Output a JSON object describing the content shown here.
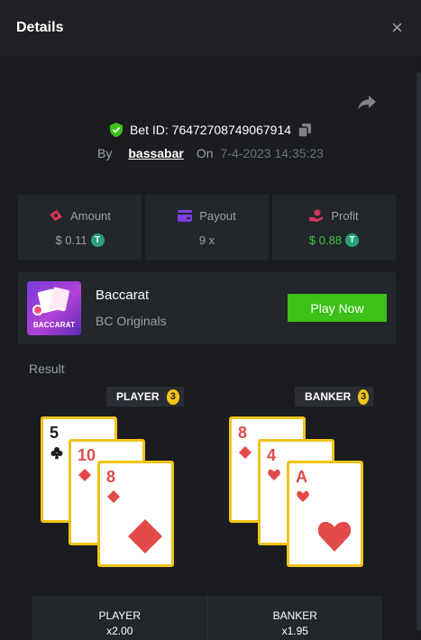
{
  "header": {
    "title": "Details",
    "close_label": "×"
  },
  "bet": {
    "id_label": "Bet ID: 76472708749067914",
    "by_label": "By",
    "user": "bassabar",
    "on_label": "On",
    "date": "7-4-2023 14:35:23"
  },
  "stats": {
    "amount": {
      "label": "Amount",
      "value": "$ 0.11",
      "icon": "money-icon"
    },
    "payout": {
      "label": "Payout",
      "value": "9 x",
      "icon": "wallet-icon"
    },
    "profit": {
      "label": "Profit",
      "value": "$ 0.88",
      "icon": "hand-coin-icon"
    }
  },
  "game": {
    "name": "Baccarat",
    "provider": "BC Originals",
    "thumb_tag": "BACCARAT",
    "play_label": "Play Now"
  },
  "result": {
    "label": "Result",
    "player": {
      "label": "PLAYER",
      "count": "3",
      "cards": [
        {
          "rank": "5",
          "suit": "club",
          "color": "black"
        },
        {
          "rank": "10",
          "suit": "diamond",
          "color": "red"
        },
        {
          "rank": "8",
          "suit": "diamond",
          "color": "red"
        }
      ]
    },
    "banker": {
      "label": "BANKER",
      "count": "3",
      "cards": [
        {
          "rank": "8",
          "suit": "diamond",
          "color": "red"
        },
        {
          "rank": "4",
          "suit": "heart",
          "color": "red"
        },
        {
          "rank": "A",
          "suit": "heart",
          "color": "red"
        }
      ]
    }
  },
  "bets": {
    "player": {
      "label": "PLAYER",
      "multiplier": "x2.00"
    },
    "banker": {
      "label": "BANKER",
      "multiplier": "x1.95"
    }
  },
  "colors": {
    "accent_green": "#3bc117",
    "card_border": "#f2c21b",
    "suit_red": "#e24a4a",
    "tether": "#26a17b"
  }
}
